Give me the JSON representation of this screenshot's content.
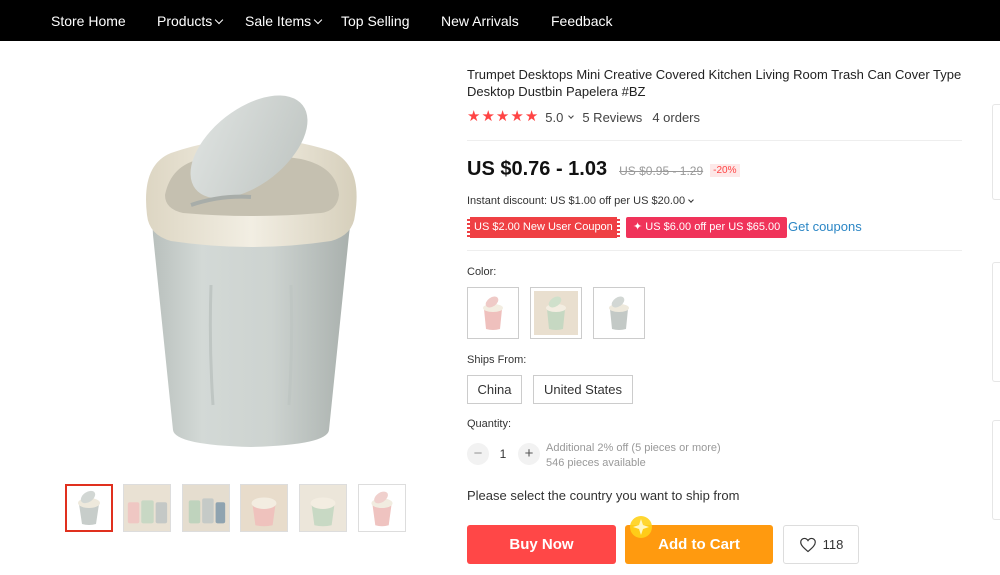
{
  "nav": {
    "items": [
      {
        "label": "Store Home"
      },
      {
        "label": "Products"
      },
      {
        "label": "Sale Items"
      },
      {
        "label": "Top Selling"
      },
      {
        "label": "New Arrivals"
      },
      {
        "label": "Feedback"
      }
    ]
  },
  "product": {
    "title": "Trumpet Desktops Mini Creative Covered Kitchen Living Room Trash Can Cover Type Desktop Dustbin Papelera #BZ",
    "rating": "5.0",
    "stars": 5,
    "reviews": "5 Reviews",
    "orders": "4 orders",
    "price": "US $0.76 - 1.03",
    "original_price": "US $0.95 - 1.29",
    "discount": "-20%",
    "instant_discount": "Instant discount: US $1.00 off per US $20.00",
    "coupons": [
      "US $2.00 New User Coupon",
      "US $6.00 off per US $65.00"
    ],
    "coupon_plus_icon": "plus-icon",
    "get_coupons": "Get coupons",
    "color_label": "Color:",
    "colors": [
      "pink",
      "green",
      "grey"
    ],
    "ships_from_label": "Ships From:",
    "ships_from": [
      "China",
      "United States"
    ],
    "quantity_label": "Quantity:",
    "quantity": "1",
    "qty_minus": "−",
    "qty_plus": "+",
    "qty_note1": "Additional 2% off (5 pieces or more)",
    "qty_note2": "546 pieces available",
    "ship_note": "Please select the country you want to ship from",
    "buy_now": "Buy Now",
    "add_to_cart": "Add to Cart",
    "wishlist_count": "118",
    "wishlist_icon": "heart-icon"
  },
  "colors": {
    "accent_red": "#ff4747",
    "accent_orange": "#ff9a0f",
    "coupon_pink": "#f0335a",
    "link_blue": "#2b86c5",
    "star": "#ff4444"
  }
}
